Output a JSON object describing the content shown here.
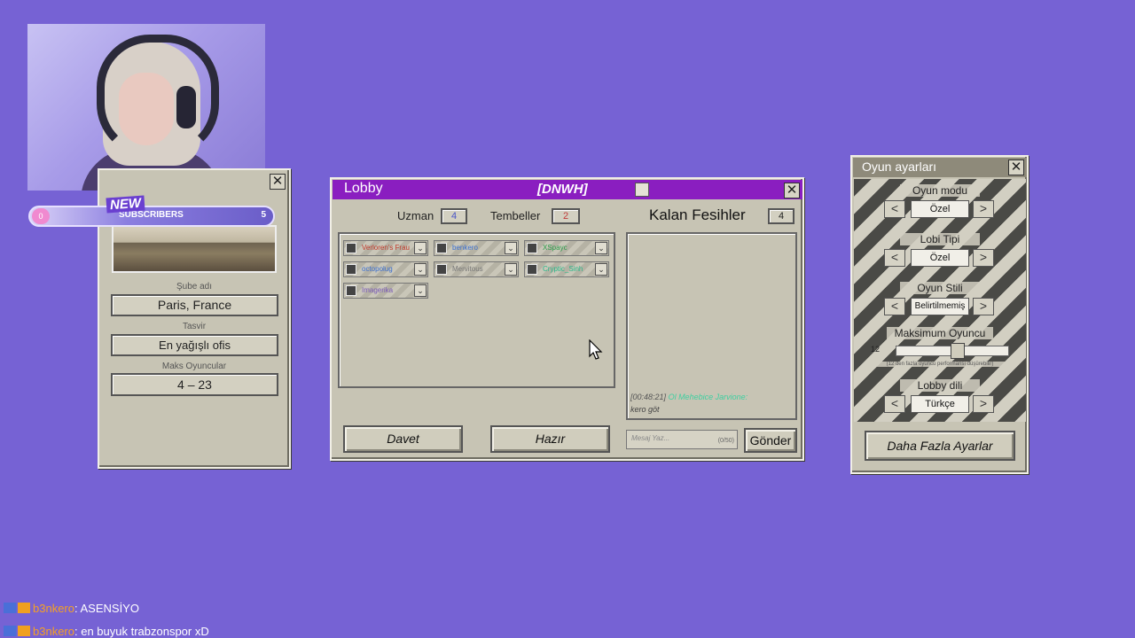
{
  "stream": {
    "new_badge": "NEW",
    "subs_label": "SUBSCRIBERS",
    "subs_start": "0",
    "subs_count": "5"
  },
  "branch": {
    "branch_label": "Şube adı",
    "branch_value": "Paris, France",
    "desc_label": "Tasvir",
    "desc_value": "En yağışlı ofis",
    "max_label": "Maks Oyuncular",
    "max_value": "4 – 23"
  },
  "lobby": {
    "title": "Lobby",
    "code": "[DNWH]",
    "expert_label": "Uzman",
    "expert_value": "4",
    "lazy_label": "Tembeller",
    "lazy_value": "2",
    "remaining_label": "Kalan Fesihler",
    "remaining_value": "4",
    "players": [
      {
        "name": "Verloren's Frau",
        "color": "#c0392b"
      },
      {
        "name": "benkero",
        "color": "#3b6fd0"
      },
      {
        "name": "XSpayc",
        "color": "#2a9d4a"
      },
      {
        "name": "octopolug",
        "color": "#3b6fd0"
      },
      {
        "name": "Mervitous",
        "color": "#777777"
      },
      {
        "name": "Cryptic_Sinh",
        "color": "#2ab88a"
      },
      {
        "name": "Imagerika",
        "color": "#7a5ab8"
      }
    ],
    "chat_time": "[00:48:21]",
    "chat_user": "Ol Mehebice Jarvione:",
    "chat_msg": "kero göt",
    "invite_button": "Davet",
    "ready_button": "Hazır",
    "message_placeholder": "Mesaj Yaz...",
    "message_counter": "(0/50)",
    "send_button": "Gönder"
  },
  "settings": {
    "title": "Oyun ayarları",
    "mode_label": "Oyun modu",
    "mode_value": "Özel",
    "lobby_type_label": "Lobi Tipi",
    "lobby_type_value": "Özel",
    "style_label": "Oyun Stili",
    "style_value": "Belirtilmemiş",
    "max_players_label": "Maksimum Oyuncu",
    "max_players_value": "12",
    "max_players_level": 0.55,
    "max_players_note": "(12 den fazla oyuncu performansı düşürebilir)",
    "language_label": "Lobby dili",
    "language_value": "Türkçe",
    "more_settings_button": "Daha Fazla Ayarlar"
  },
  "chat": [
    {
      "user": "b3nkero",
      "message": ": ASENSİYO"
    },
    {
      "user": "b3nkero",
      "message": ": en buyuk trabzonspor xD"
    }
  ]
}
